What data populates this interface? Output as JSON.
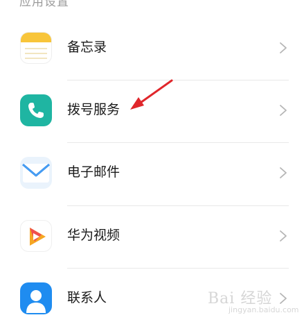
{
  "header": {
    "title": "应用设置"
  },
  "rows": [
    {
      "label": "备忘录",
      "icon": "memo-icon"
    },
    {
      "label": "拨号服务",
      "icon": "phone-icon"
    },
    {
      "label": "电子邮件",
      "icon": "mail-icon"
    },
    {
      "label": "华为视频",
      "icon": "video-icon"
    },
    {
      "label": "联系人",
      "icon": "contacts-icon"
    }
  ],
  "colors": {
    "memo": "#f8c53a",
    "phone": "#1fb5a2",
    "mail": "#2f8ef0",
    "video": "#f04f4f",
    "contacts": "#1f8cf0",
    "annotation_arrow": "#e0262b"
  },
  "watermark": {
    "text": "Bai 经验",
    "sub": "jingyan.baidu.com"
  }
}
